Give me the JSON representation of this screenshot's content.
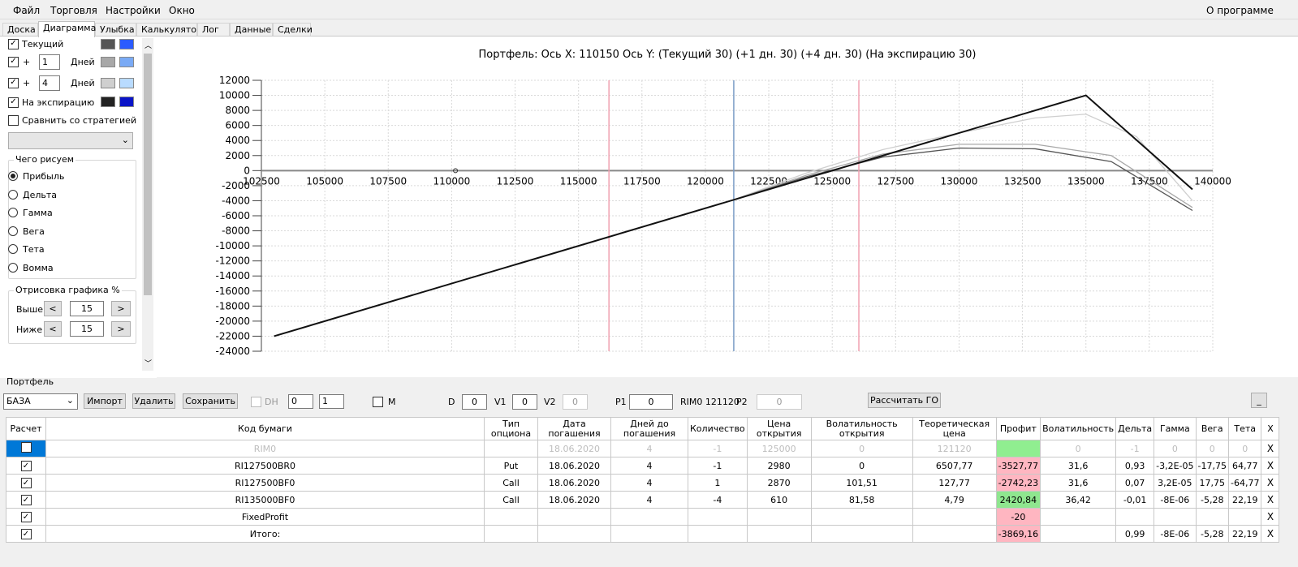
{
  "menu": {
    "file": "Файл",
    "trade": "Торговля",
    "settings": "Настройки",
    "window": "Окно",
    "about": "О программе"
  },
  "tabs": [
    "Доска",
    "Диаграмма",
    "Улыбка",
    "Калькулятор",
    "Лог",
    "Данные",
    "Сделки"
  ],
  "sidebar": {
    "current_label": "Текущий",
    "plus_label": "+",
    "days_label": "Дней",
    "day1": "1",
    "day2": "4",
    "expiry_label": "На экспирацию",
    "compare_label": "Сравнить со стратегией",
    "draw_group": "Чего рисуем",
    "radio": [
      "Прибыль",
      "Дельта",
      "Гамма",
      "Вега",
      "Тета",
      "Вомма"
    ],
    "render_group": "Отрисовка графика %",
    "above_label": "Выше",
    "below_label": "Ниже",
    "above_value": "15",
    "below_value": "15",
    "left_arrow": "<",
    "right_arrow": ">",
    "colors": {
      "current": [
        "#555555",
        "#2b5bff"
      ],
      "d1": [
        "#a8a8a8",
        "#7aaaf5"
      ],
      "d4": [
        "#cfcfcf",
        "#b9dbff"
      ],
      "expiry": [
        "#222222",
        "#0a14c8"
      ]
    }
  },
  "chart": {
    "title": "Портфель: Ось X:  110150 Ось Y:  (Текущий 30)  (+1 дн. 30)  (+4 дн. 30)  (На экспирацию 30)"
  },
  "chart_data": {
    "type": "line",
    "xlim": [
      102500,
      140000
    ],
    "ylim": [
      -24000,
      12000
    ],
    "x_ticks": [
      102500,
      105000,
      107500,
      110000,
      112500,
      115000,
      117500,
      120000,
      122500,
      125000,
      127500,
      130000,
      132500,
      135000,
      137500,
      140000
    ],
    "y_ticks": [
      12000,
      10000,
      8000,
      6000,
      4000,
      2000,
      0,
      -2000,
      -4000,
      -6000,
      -8000,
      -10000,
      -12000,
      -14000,
      -16000,
      -18000,
      -20000,
      -22000,
      -24000
    ],
    "vertical_lines": [
      {
        "x": 116200,
        "color": "#f0a0b0"
      },
      {
        "x": 121120,
        "color": "#7a9cc6"
      },
      {
        "x": 126050,
        "color": "#f0a0b0"
      }
    ],
    "series": [
      {
        "x": [
          103000,
          135000,
          139200
        ],
        "y": [
          -22000,
          10000,
          -2500
        ],
        "color": "#111111"
      },
      {
        "x": [
          103000,
          121000,
          124000,
          127000,
          130000,
          133000,
          136000,
          139200
        ],
        "y": [
          -22000,
          -4000,
          -800,
          1800,
          3000,
          2900,
          1200,
          -5300
        ],
        "color": "#555555"
      },
      {
        "x": [
          103000,
          121000,
          124000,
          127000,
          130000,
          133000,
          136000,
          139200
        ],
        "y": [
          -22000,
          -4000,
          -600,
          2200,
          3500,
          3500,
          2000,
          -4900
        ],
        "color": "#a8a8a8"
      },
      {
        "x": [
          103000,
          121000,
          124000,
          127000,
          130000,
          133000,
          135000,
          137000,
          139200
        ],
        "y": [
          -22000,
          -4000,
          -300,
          2800,
          5000,
          7000,
          7500,
          4500,
          -4000
        ],
        "color": "#cfcfcf"
      }
    ]
  },
  "portfolio": {
    "group_title": "Портфель",
    "select_value": "БАЗА",
    "import": "Импорт",
    "delete": "Удалить",
    "save": "Сохранить",
    "dh": "DH",
    "dh_v1": "0",
    "dh_v2": "1",
    "m": "M",
    "d_label": "D",
    "d_value": "0",
    "v1_label": "V1",
    "v1_value": "0",
    "v2_label": "V2",
    "v2_value": "0",
    "p1_label": "P1",
    "p1_value": "0",
    "rim_text": "RIM0 121120",
    "p2_label": "P2",
    "p2_value": "0",
    "calc_go": "Рассчитать ГО",
    "minimize": "_",
    "headers": [
      "Расчет",
      "Код бумаги",
      "Тип опциона",
      "Дата погашения",
      "Дней до погашения",
      "Количество",
      "Цена открытия",
      "Волатильность открытия",
      "Теоретическая цена",
      "Профит",
      "Волатильность",
      "Дельта",
      "Гамма",
      "Вега",
      "Тета",
      "X"
    ],
    "rows": [
      {
        "code": "RIM0",
        "type": "",
        "date": "18.06.2020",
        "days": "4",
        "qty": "-1",
        "price": "125000",
        "vol_open": "0",
        "theo": "121120",
        "profit": "",
        "vol": "0",
        "delta": "-1",
        "gamma": "0",
        "vega": "0",
        "theta": "0",
        "x": "X"
      },
      {
        "code": "RI127500BR0",
        "type": "Put",
        "date": "18.06.2020",
        "days": "4",
        "qty": "-1",
        "price": "2980",
        "vol_open": "0",
        "theo": "6507,77",
        "profit": "-3527,77",
        "vol": "31,6",
        "delta": "0,93",
        "gamma": "-3,2E-05",
        "vega": "-17,75",
        "theta": "64,77",
        "x": "X"
      },
      {
        "code": "RI127500BF0",
        "type": "Call",
        "date": "18.06.2020",
        "days": "4",
        "qty": "1",
        "price": "2870",
        "vol_open": "101,51",
        "theo": "127,77",
        "profit": "-2742,23",
        "vol": "31,6",
        "delta": "0,07",
        "gamma": "3,2E-05",
        "vega": "17,75",
        "theta": "-64,77",
        "x": "X"
      },
      {
        "code": "RI135000BF0",
        "type": "Call",
        "date": "18.06.2020",
        "days": "4",
        "qty": "-4",
        "price": "610",
        "vol_open": "81,58",
        "theo": "4,79",
        "profit": "2420,84",
        "vol": "36,42",
        "delta": "-0,01",
        "gamma": "-8E-06",
        "vega": "-5,28",
        "theta": "22,19",
        "x": "X"
      },
      {
        "code": "FixedProfit",
        "type": "",
        "date": "",
        "days": "",
        "qty": "",
        "price": "",
        "vol_open": "",
        "theo": "",
        "profit": "-20",
        "vol": "",
        "delta": "",
        "gamma": "",
        "vega": "",
        "theta": "",
        "x": "X"
      },
      {
        "code": "Итого:",
        "type": "",
        "date": "",
        "days": "",
        "qty": "",
        "price": "",
        "vol_open": "",
        "theo": "",
        "profit": "-3869,16",
        "vol": "",
        "delta": "0,99",
        "gamma": "-8E-06",
        "vega": "-5,28",
        "theta": "22,19",
        "x": "X"
      }
    ]
  }
}
